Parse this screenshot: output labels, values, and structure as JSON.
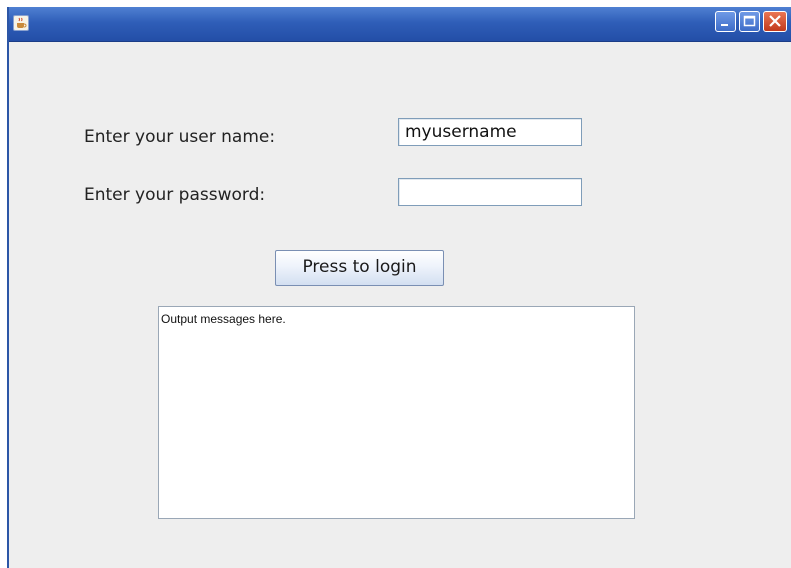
{
  "window": {
    "icon": "java-coffee-cup-icon",
    "controls": [
      "minimize-icon",
      "maximize-icon",
      "close-icon"
    ]
  },
  "form": {
    "username_label": "Enter your user name:",
    "username_value": "myusername",
    "password_label": "Enter your password:",
    "password_value": "",
    "login_button": "Press to login"
  },
  "output": {
    "text": "Output messages here."
  },
  "colors": {
    "titlebar": "#2f5eb8",
    "close_button": "#c2391b",
    "window_bg": "#eeeeee"
  }
}
